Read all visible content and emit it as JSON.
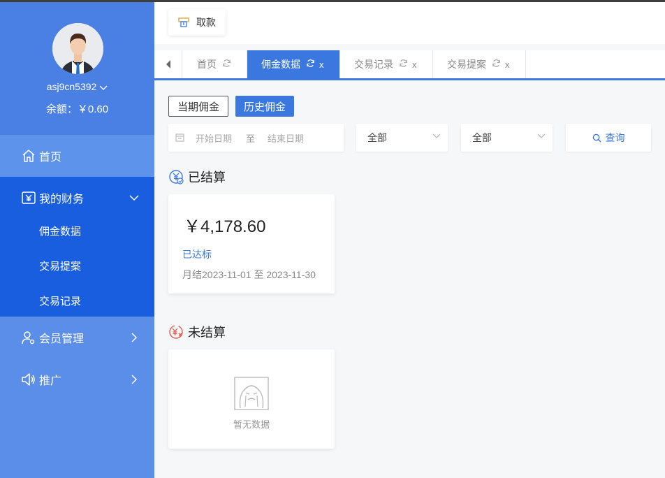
{
  "sidebar": {
    "username": "asj9cn5392",
    "balance": "余额：￥0.60",
    "nav": {
      "home": "首页",
      "finance": "我的财务",
      "finance_sub": [
        "佣金数据",
        "交易提案",
        "交易记录"
      ],
      "member": "会员管理",
      "promo": "推广"
    }
  },
  "header": {
    "withdraw_label": "取款"
  },
  "tabs": [
    {
      "label": "首页"
    },
    {
      "label": "佣金数据",
      "close": "x"
    },
    {
      "label": "交易记录",
      "close": "x"
    },
    {
      "label": "交易提案",
      "close": "x"
    }
  ],
  "filters": {
    "current_period": "当期佣金",
    "history": "历史佣金",
    "start_placeholder": "开始日期",
    "date_sep": "至",
    "end_placeholder": "结束日期",
    "select1": "全部",
    "select2": "全部",
    "query": "查询"
  },
  "settled": {
    "title": "已结算",
    "amount": "￥4,178.60",
    "status": "已达标",
    "period": "月结2023-11-01 至 2023-11-30"
  },
  "unsettled": {
    "title": "未结算",
    "empty_text": "暂无数据"
  },
  "colors": {
    "primary": "#3a78e0",
    "sidebar": "#5b8ee8",
    "sidebar_active": "#1a5ee0"
  }
}
